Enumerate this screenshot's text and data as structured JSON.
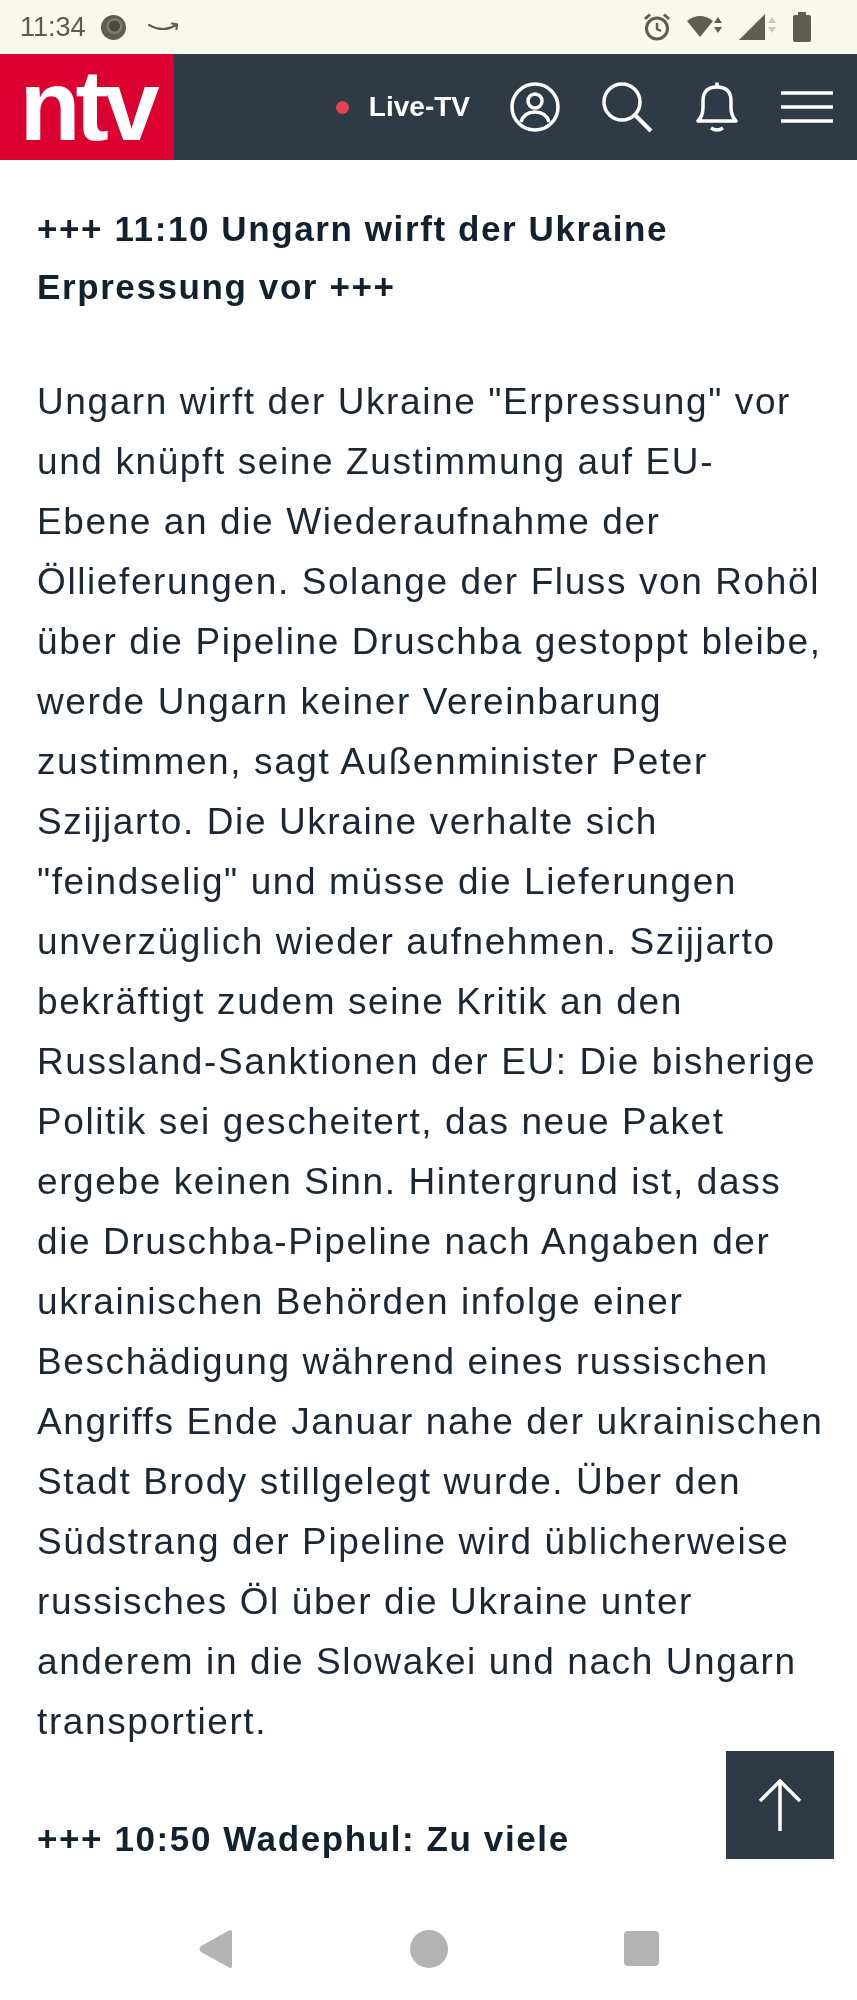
{
  "status_bar": {
    "time": "11:34"
  },
  "header": {
    "logo": "ntv",
    "live_label": "Live-TV"
  },
  "posts": [
    {
      "heading": "+++ 11:10 Ungarn wirft der Ukraine Erpressung vor +++",
      "body": "Ungarn wirft der Ukraine \"Erpressung\" vor und knüpft seine Zustimmung auf EU-Ebene an die Wiederaufnahme der Öllieferungen. Solange der Fluss von Rohöl über die Pipeline Druschba gestoppt bleibe, werde Ungarn keiner Vereinbarung zustimmen, sagt Außenminister Peter Szijjarto. Die Ukraine verhalte sich \"feindselig\" und müsse die Lieferungen unverzüglich wieder aufnehmen. Szijjarto bekräftigt zudem seine Kritik an den Russland-Sanktionen der EU: Die bisherige Politik sei gescheitert, das neue Paket ergebe keinen Sinn. Hintergrund ist, dass die Druschba-Pipeline nach Angaben der ukrainischen Behörden infolge einer Beschädigung während eines russischen Angriffs Ende Januar nahe der ukrainischen Stadt Brody stillgelegt wurde. Über den Südstrang der Pipeline wird üblicherweise russisches Öl über die Ukraine unter anderem in die Slowakei und nach Ungarn transportiert."
    },
    {
      "heading": "+++ 10:50 Wadephul: Zu viele"
    }
  ]
}
